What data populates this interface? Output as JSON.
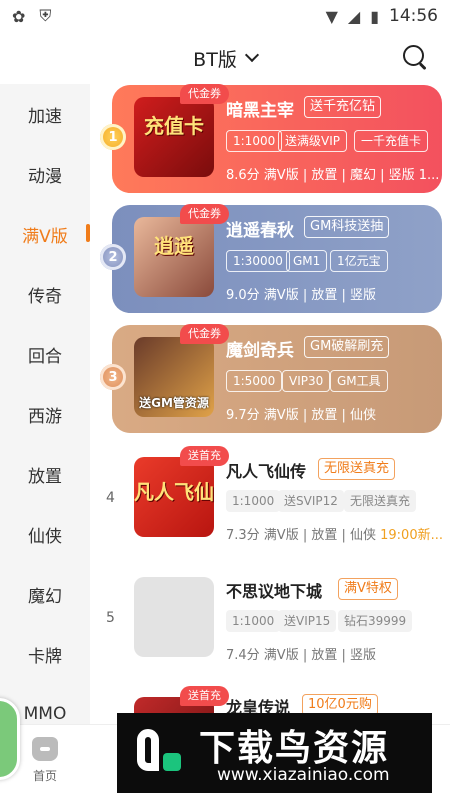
{
  "status_bar": {
    "time": "14:56",
    "left_icons": [
      "app-notification-icon",
      "shield-icon"
    ],
    "right_icons": [
      "wifi-icon",
      "signal-icon",
      "battery-icon"
    ]
  },
  "header": {
    "title": "BT版",
    "dropdown_icon": "chevron-down-icon",
    "search_icon": "search-icon"
  },
  "sidebar": {
    "active_index": 2,
    "items": [
      {
        "label": "加速"
      },
      {
        "label": "动漫"
      },
      {
        "label": "满V版"
      },
      {
        "label": "传奇"
      },
      {
        "label": "回合"
      },
      {
        "label": "西游"
      },
      {
        "label": "放置"
      },
      {
        "label": "仙侠"
      },
      {
        "label": "魔幻"
      },
      {
        "label": "卡牌"
      },
      {
        "label": "MMO"
      }
    ]
  },
  "games": [
    {
      "rank": "1",
      "badge": "代金券",
      "thumb_text": "充值卡",
      "title": "暗黑主宰",
      "promo": "送千充亿钻",
      "chips": [
        "1:1000",
        "送满级VIP",
        "一千充值卡"
      ],
      "meta": "8.6分 满V版 | 放置 | 魔幻 | 竖版 1..."
    },
    {
      "rank": "2",
      "badge": "代金券",
      "thumb_text": "逍遥",
      "title": "逍遥春秋",
      "promo": "GM科技送抽",
      "chips": [
        "1:30000",
        "GM1",
        "1亿元宝"
      ],
      "meta": "9.0分 满V版 | 放置 | 竖版"
    },
    {
      "rank": "3",
      "badge": "代金券",
      "thumb_text": "送GM管资源",
      "title": "魔剑奇兵",
      "promo": "GM破解刷充",
      "chips": [
        "1:5000",
        "VIP30",
        "GM工具"
      ],
      "meta": "9.7分 满V版 | 放置 | 仙侠"
    },
    {
      "rank": "4",
      "badge": "送首充",
      "thumb_text": "凡人飞仙",
      "title": "凡人飞仙传",
      "promo": "无限送真充",
      "chips": [
        "1:1000",
        "送SVIP12",
        "无限送真充"
      ],
      "meta": "7.3分 满V版 | 放置 | 仙侠 ",
      "time": "19:00新..."
    },
    {
      "rank": "5",
      "badge": "",
      "thumb_text": "",
      "title": "不思议地下城",
      "promo": "满V特权",
      "chips": [
        "1:1000",
        "送VIP15",
        "钻石39999"
      ],
      "meta": "7.4分 满V版 | 放置 | 竖版"
    },
    {
      "rank": "6",
      "badge": "送首充",
      "thumb_text": "",
      "title": "龙皇传说",
      "promo": "10亿0元购"
    }
  ],
  "bottom_nav": {
    "home_label": "首页",
    "home_icon": "home-icon"
  },
  "watermark": {
    "title": "下载鸟资源",
    "url": "www.xiazainiao.com"
  }
}
